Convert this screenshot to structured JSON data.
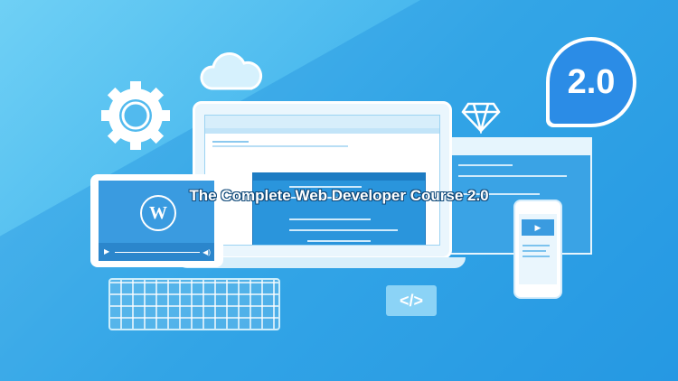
{
  "title": "The Complete Web Developer Course 2.0",
  "badge": {
    "version": "2.0",
    "color": "#2b8ce6"
  },
  "tablet": {
    "logo": "W"
  },
  "code_bubble": {
    "text": "</>"
  },
  "colors": {
    "background": "#3fb2ec",
    "accent": "#2a95dc"
  },
  "icons": [
    "gear-icon",
    "cloud-icon",
    "diamond-icon",
    "play-icon",
    "volume-icon"
  ]
}
